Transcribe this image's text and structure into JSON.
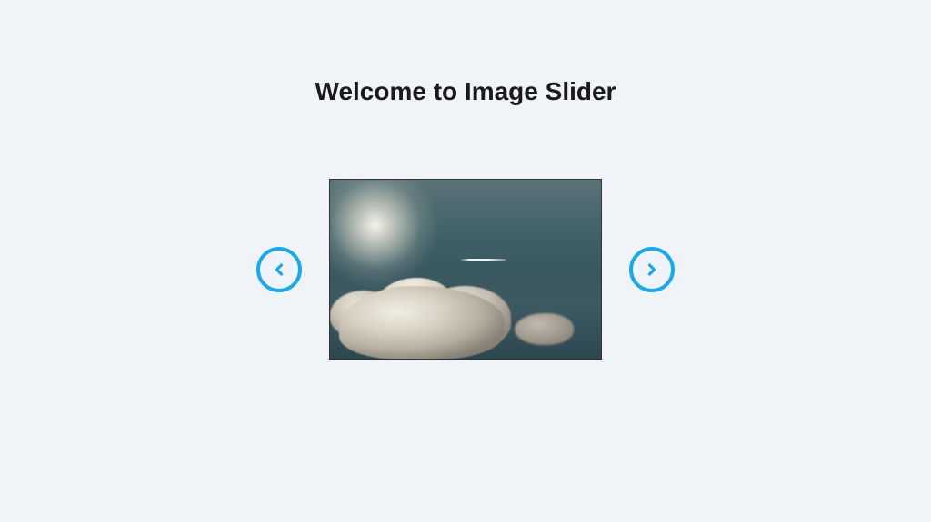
{
  "heading": "Welcome to Image Slider",
  "slider": {
    "prev_label": "Previous",
    "next_label": "Next",
    "current_image_alt": "Sky with clouds and sunlight",
    "accent_color": "#1ba9e8"
  }
}
